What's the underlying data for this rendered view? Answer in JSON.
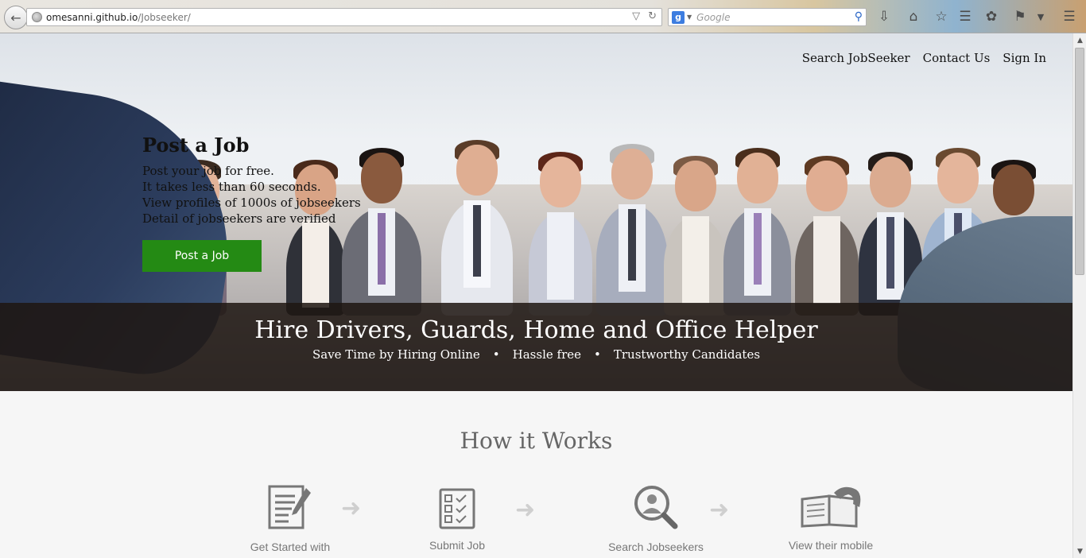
{
  "browser": {
    "url_host": "omesanni.github.io",
    "url_path": "/Jobseeker/",
    "search_placeholder": "Google"
  },
  "nav": {
    "items": [
      "Search JobSeeker",
      "Contact Us",
      "Sign In"
    ]
  },
  "hero": {
    "post_title": "Post a Job",
    "post_lines": [
      "Post your job for free.",
      "It takes less than 60 seconds.",
      "View profiles of 1000s of jobseekers",
      "Detail of jobseekers are verified"
    ],
    "post_button": "Post a Job",
    "banner_title": "Hire Drivers, Guards, Home and Office Helper",
    "banner_sub": [
      "Save Time by Hiring Online",
      "Hassle free",
      "Trustworthy Candidates"
    ]
  },
  "how": {
    "title": "How it Works",
    "steps": [
      {
        "label": "Get Started with",
        "icon": "document-pencil-icon"
      },
      {
        "label": "Submit Job",
        "icon": "checklist-icon"
      },
      {
        "label": "Search Jobseekers",
        "icon": "search-person-icon"
      },
      {
        "label": "View their mobile",
        "icon": "phone-book-icon"
      }
    ]
  },
  "colors": {
    "post_button_bg": "#248a14",
    "banner_bg": "#1e1612"
  }
}
